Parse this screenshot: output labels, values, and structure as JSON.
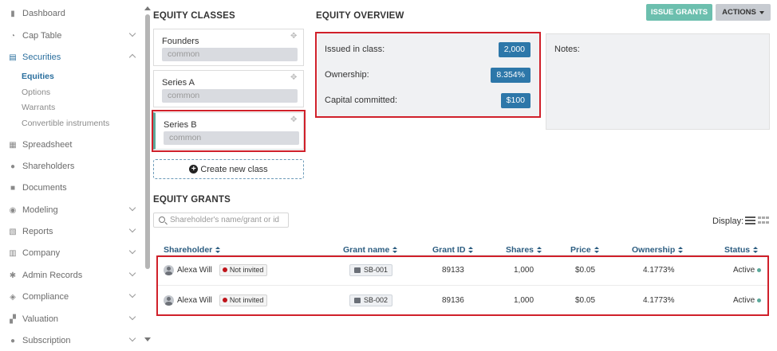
{
  "sidebar": {
    "items": [
      {
        "label": "Dashboard",
        "icon": "dashboard-icon",
        "glyph": "▮"
      },
      {
        "label": "Cap Table",
        "icon": "pie-chart-icon",
        "glyph": "◔"
      },
      {
        "label": "Securities",
        "icon": "clipboard-icon",
        "glyph": "▤"
      },
      {
        "label": "Spreadsheet",
        "icon": "spreadsheet-icon",
        "glyph": "▦"
      },
      {
        "label": "Shareholders",
        "icon": "user-icon",
        "glyph": "●"
      },
      {
        "label": "Documents",
        "icon": "folder-icon",
        "glyph": "■"
      },
      {
        "label": "Modeling",
        "icon": "lightbulb-icon",
        "glyph": "◉"
      },
      {
        "label": "Reports",
        "icon": "report-icon",
        "glyph": "▧"
      },
      {
        "label": "Company",
        "icon": "building-icon",
        "glyph": "▥"
      },
      {
        "label": "Admin Records",
        "icon": "gear-icon",
        "glyph": "✱"
      },
      {
        "label": "Compliance",
        "icon": "shield-icon",
        "glyph": "◈"
      },
      {
        "label": "Valuation",
        "icon": "valuation-icon",
        "glyph": "▞"
      },
      {
        "label": "Subscription",
        "icon": "info-icon",
        "glyph": "●"
      }
    ],
    "securities_sub": [
      "Equities",
      "Options",
      "Warrants",
      "Convertible instruments"
    ]
  },
  "classes": {
    "title": "EQUITY CLASSES",
    "items": [
      {
        "name": "Founders",
        "type": "common"
      },
      {
        "name": "Series A",
        "type": "common"
      },
      {
        "name": "Series B",
        "type": "common"
      }
    ],
    "create_label": "Create new class"
  },
  "overview": {
    "title": "EQUITY OVERVIEW",
    "issued_label": "Issued in class:",
    "issued_value": "2,000",
    "ownership_label": "Ownership:",
    "ownership_value": "8.354%",
    "capital_label": "Capital committed:",
    "capital_value": "$100",
    "notes_label": "Notes:"
  },
  "toolbar": {
    "issue_label": "ISSUE GRANTS",
    "actions_label": "ACTIONS"
  },
  "grants": {
    "title": "EQUITY GRANTS",
    "search_placeholder": "Shareholder's name/grant or id",
    "display_label": "Display:",
    "columns": [
      "Shareholder",
      "Grant name",
      "Grant ID",
      "Shares",
      "Price",
      "Ownership",
      "Status"
    ],
    "rows": [
      {
        "shareholder": "Alexa Will",
        "invite": "Not invited",
        "grant_name": "SB-001",
        "grant_id": "89133",
        "shares": "1,000",
        "price": "$0.05",
        "ownership": "4.1773%",
        "status": "Active"
      },
      {
        "shareholder": "Alexa Will",
        "invite": "Not invited",
        "grant_name": "SB-002",
        "grant_id": "89136",
        "shares": "1,000",
        "price": "$0.05",
        "ownership": "4.1773%",
        "status": "Active"
      }
    ]
  },
  "colors": {
    "accent": "#2d77a9",
    "highlight": "#d0202a",
    "teal": "#6cbfae"
  }
}
